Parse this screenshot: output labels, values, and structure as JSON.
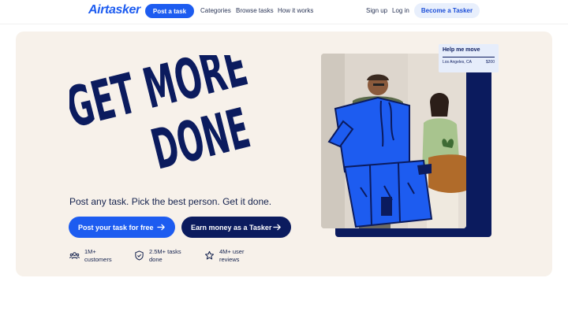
{
  "nav": {
    "logo": "Airtasker",
    "post_task": "Post a task",
    "links": [
      "Categories",
      "Browse tasks",
      "How it works"
    ],
    "sign_up": "Sign up",
    "log_in": "Log in",
    "become_tasker": "Become a Tasker"
  },
  "hero": {
    "headline_line1": "GET MORE",
    "headline_line2": "DONE",
    "tagline": "Post any task. Pick the best person. Get it done.",
    "cta_primary": "Post your task for free",
    "cta_secondary": "Earn money as a Tasker",
    "stats": [
      {
        "icon": "users-icon",
        "line1": "1M+",
        "line2": "customers"
      },
      {
        "icon": "shield-check-icon",
        "line1": "2.5M+ tasks",
        "line2": "done"
      },
      {
        "icon": "star-icon",
        "line1": "4M+ user",
        "line2": "reviews"
      }
    ]
  },
  "task_card": {
    "title": "Help me move",
    "location": "Los Angeles, CA",
    "price": "$200"
  },
  "colors": {
    "brand_blue": "#1d5cf0",
    "navy": "#0b1b5e",
    "hero_bg": "#f7f1ea"
  }
}
